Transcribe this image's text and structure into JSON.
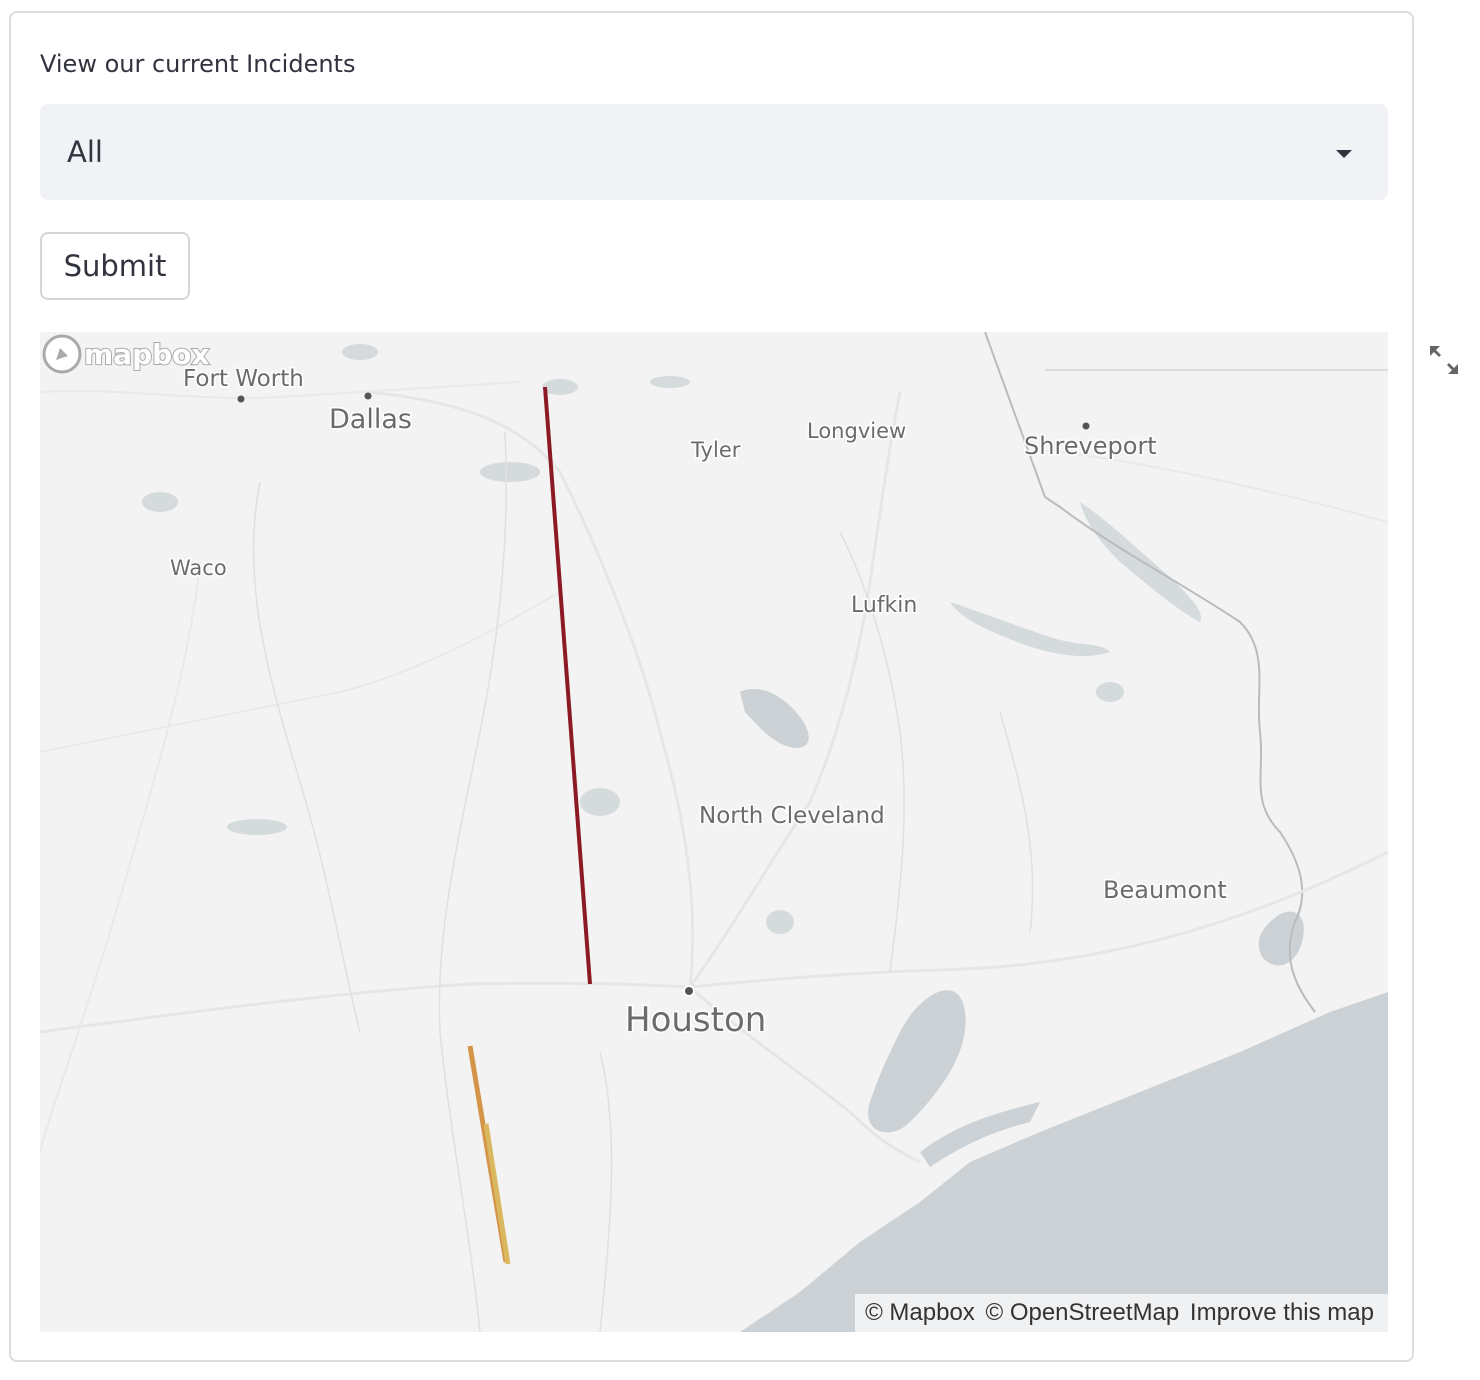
{
  "form": {
    "label": "View our current Incidents",
    "select_value": "All",
    "submit_label": "Submit"
  },
  "map": {
    "cities": {
      "fort_worth": "Fort Worth",
      "dallas": "Dallas",
      "tyler": "Tyler",
      "longview": "Longview",
      "shreveport": "Shreveport",
      "waco": "Waco",
      "lufkin": "Lufkin",
      "north_cleveland": "North Cleveland",
      "beaumont": "Beaumont",
      "houston": "Houston"
    },
    "incident_colors": {
      "red_line": "#8b1a24",
      "orange_line": "#d4954a",
      "yellow_line": "#d9b860"
    },
    "water_color": "#cbd1d4",
    "land_color": "#f3f3f3",
    "logo_text": "mapbox",
    "attribution": {
      "mapbox": "© Mapbox",
      "osm": "© OpenStreetMap",
      "improve": "Improve this map"
    },
    "fullscreen_icon": "expand-icon"
  }
}
